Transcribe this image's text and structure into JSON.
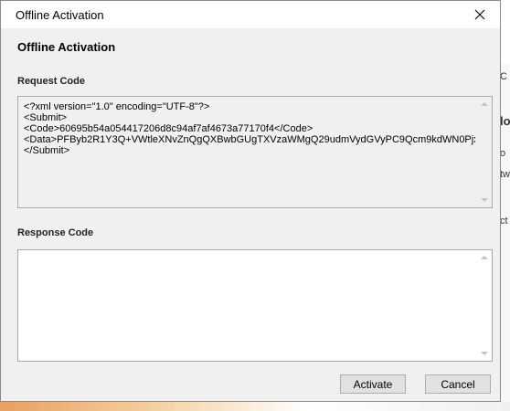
{
  "window": {
    "title": "Offline Activation"
  },
  "dialog": {
    "heading": "Offline Activation",
    "request": {
      "label": "Request Code",
      "value": "<?xml version=\"1.0\" encoding=\"UTF-8\"?>\n<Submit>\n<Code>60695b54a054417206d8c94af7af4673a77170f4</Code>\n<Data>PFByb2R1Y3Q+VWtleXNvZnQgQXBwbGUgTXVzaWMgQ29udmVydGVyPC9Qcm9kdWN0Pjxjb21w\n</Submit>"
    },
    "response": {
      "label": "Response Code",
      "value": ""
    },
    "buttons": {
      "activate": "Activate",
      "cancel": "Cancel"
    }
  },
  "background": {
    "fragments": [
      "C",
      "lo",
      "o",
      "tw",
      "ct"
    ]
  }
}
